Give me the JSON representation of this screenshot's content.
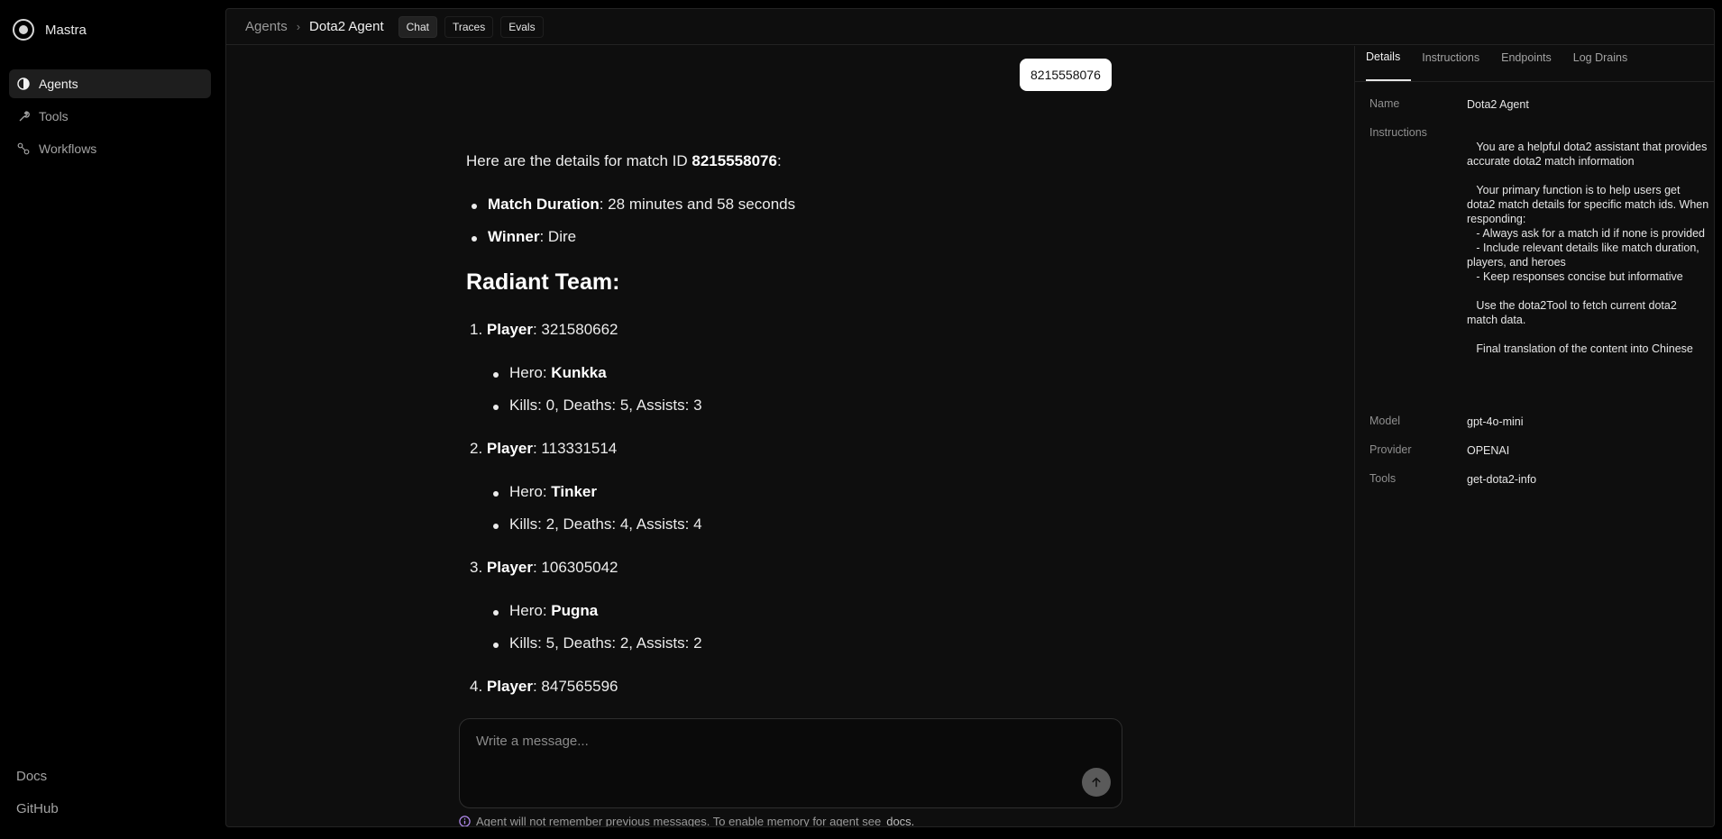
{
  "brand": {
    "name": "Mastra"
  },
  "sidebar": {
    "items": [
      {
        "label": "Agents",
        "icon": "agent-icon",
        "active": true
      },
      {
        "label": "Tools",
        "icon": "tools-icon",
        "active": false
      },
      {
        "label": "Workflows",
        "icon": "workflow-icon",
        "active": false
      }
    ],
    "footer": {
      "docs": "Docs",
      "github": "GitHub"
    }
  },
  "topbar": {
    "breadcrumb_root": "Agents",
    "breadcrumb_current": "Dota2 Agent",
    "tabs": [
      "Chat",
      "Traces",
      "Evals"
    ],
    "active_tab": "Chat"
  },
  "chat": {
    "user_message": "8215558076",
    "intro_text": "Here are the details for match ID ",
    "intro_bold": "8215558076",
    "intro_suffix": ":",
    "summary": {
      "duration_label": "Match Duration",
      "duration_value": ": 28 minutes and 58 seconds",
      "winner_label": "Winner",
      "winner_value": ": Dire"
    },
    "team_heading": "Radiant Team:",
    "players": [
      {
        "num": "1.",
        "label": "Player",
        "id": ": 321580662",
        "hero_prefix": "Hero: ",
        "hero": "Kunkka",
        "stats": "Kills: 0, Deaths: 5, Assists: 3"
      },
      {
        "num": "2.",
        "label": "Player",
        "id": ": 113331514",
        "hero_prefix": "Hero: ",
        "hero": "Tinker",
        "stats": "Kills: 2, Deaths: 4, Assists: 4"
      },
      {
        "num": "3.",
        "label": "Player",
        "id": ": 106305042",
        "hero_prefix": "Hero: ",
        "hero": "Pugna",
        "stats": "Kills: 5, Deaths: 2, Assists: 2"
      },
      {
        "num": "4.",
        "label": "Player",
        "id": ": 847565596"
      }
    ],
    "composer_placeholder": "Write a message...",
    "memory_note": "Agent will not remember previous messages. To enable memory for agent see ",
    "memory_link": "docs."
  },
  "panel": {
    "tabs": [
      "Details",
      "Instructions",
      "Endpoints",
      "Log Drains"
    ],
    "active_tab": "Details",
    "rows": {
      "name_label": "Name",
      "name_value": "Dota2 Agent",
      "instructions_label": "Instructions",
      "instructions_value": "   You are a helpful dota2 assistant that provides accurate dota2 match information\n\n   Your primary function is to help users get dota2 match details for specific match ids. When responding:\n   - Always ask for a match id if none is provided\n   - Include relevant details like match duration, players, and heroes\n   - Keep responses concise but informative\n\n   Use the dota2Tool to fetch current dota2 match data.\n\n   Final translation of the content into Chinese",
      "model_label": "Model",
      "model_value": "gpt-4o-mini",
      "provider_label": "Provider",
      "provider_value": "OPENAI",
      "tools_label": "Tools",
      "tools_value": "get-dota2-info"
    }
  }
}
